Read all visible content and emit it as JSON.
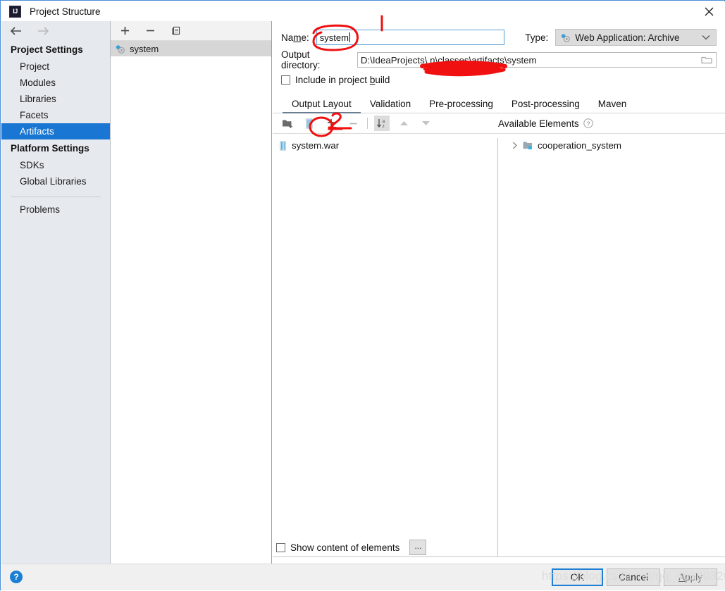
{
  "window": {
    "title": "Project Structure",
    "app_icon_text": "IJ",
    "close_icon": "close-icon"
  },
  "sidebar": {
    "back_icon": "arrow-left-icon",
    "forward_icon": "arrow-right-icon",
    "groups": [
      {
        "label": "Project Settings",
        "items": [
          {
            "label": "Project",
            "selected": false
          },
          {
            "label": "Modules",
            "selected": false
          },
          {
            "label": "Libraries",
            "selected": false
          },
          {
            "label": "Facets",
            "selected": false
          },
          {
            "label": "Artifacts",
            "selected": true
          }
        ]
      },
      {
        "label": "Platform Settings",
        "items": [
          {
            "label": "SDKs",
            "selected": false
          },
          {
            "label": "Global Libraries",
            "selected": false
          }
        ]
      }
    ],
    "problems_label": "Problems"
  },
  "artifacts_panel": {
    "toolbar": [
      {
        "icon": "plus-icon",
        "title": "Add"
      },
      {
        "icon": "minus-icon",
        "title": "Remove"
      },
      {
        "icon": "copy-icon",
        "title": "Copy"
      }
    ],
    "items": [
      {
        "label": "system",
        "icon": "artifact-icon",
        "selected": true
      }
    ]
  },
  "detail": {
    "name_label": "Name:",
    "name_value": "system",
    "type_label": "Type:",
    "type_value": "Web Application: Archive",
    "type_icon": "artifact-icon",
    "type_chevron": "chevron-down-icon",
    "output_label": "Output directory:",
    "output_value": "D:\\IdeaProjects\\                         n\\classes\\artifacts\\system",
    "output_browse_icon": "folder-icon",
    "include_label": "Include in project build",
    "include_checked": false,
    "tabs": [
      {
        "label": "Output Layout",
        "active": true
      },
      {
        "label": "Validation",
        "active": false
      },
      {
        "label": "Pre-processing",
        "active": false
      },
      {
        "label": "Post-processing",
        "active": false
      },
      {
        "label": "Maven",
        "active": false
      }
    ],
    "editor_toolbar": [
      {
        "icon": "add-directory-icon",
        "enabled": true
      },
      {
        "icon": "archive-icon",
        "enabled": true
      },
      {
        "icon": "plus-dropdown-icon",
        "enabled": true
      },
      {
        "icon": "minus-icon",
        "enabled": false
      },
      {
        "icon": "sort-alphabetical-icon",
        "enabled": true
      },
      {
        "icon": "arrow-up-icon",
        "enabled": false
      },
      {
        "icon": "arrow-down-icon",
        "enabled": false
      }
    ],
    "available_elements_label": "Available Elements",
    "available_elements_help_icon": "help-circle-icon",
    "output_tree": [
      {
        "label": "system.war",
        "icon": "archive-icon"
      }
    ],
    "available_tree": [
      {
        "label": "cooperation_system",
        "icon": "module-icon",
        "twisty": "chevron-right-icon"
      }
    ],
    "show_content_label": "Show content of elements",
    "show_content_checked": false,
    "dots_button_label": "..."
  },
  "footer": {
    "help_icon": "help-icon",
    "help_label": "?",
    "buttons": [
      {
        "label": "OK",
        "name": "ok-button",
        "primary": true
      },
      {
        "label": "Cancel",
        "name": "cancel-button",
        "primary": false
      },
      {
        "label": "Apply",
        "name": "apply-button",
        "primary": false
      }
    ]
  },
  "watermark": {
    "text": "https://blog.csdn.net/qq_46889326"
  },
  "annotations": {
    "color": "#f01010",
    "marks": [
      {
        "name": "step-1-marker",
        "shape": "vertical-stroke",
        "near": "name-input"
      },
      {
        "name": "name-field-circle",
        "shape": "ellipse",
        "near": "name-input"
      },
      {
        "name": "step-2-marker",
        "shape": "digit-2",
        "near": "add-button"
      },
      {
        "name": "add-button-circle",
        "shape": "ellipse",
        "near": "plus-dropdown-icon"
      },
      {
        "name": "output-path-scribble",
        "shape": "scribble",
        "near": "output-directory-input"
      }
    ]
  }
}
